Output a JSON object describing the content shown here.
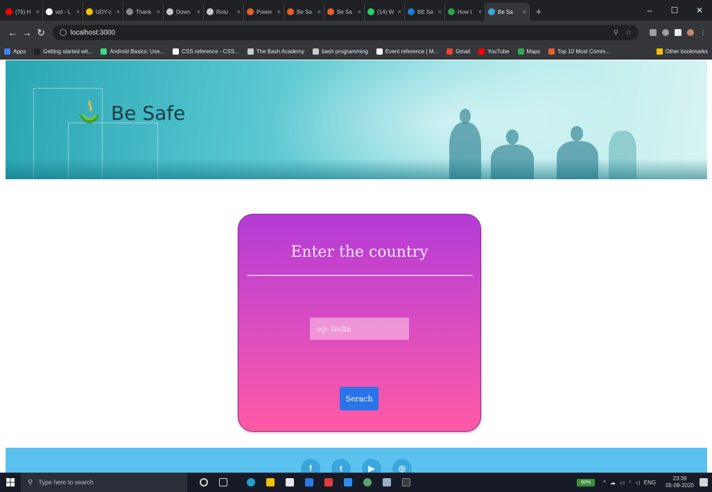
{
  "browser": {
    "tabs": [
      {
        "label": "(76) H",
        "favicon_color": "#ff0000"
      },
      {
        "label": "wd - L",
        "favicon_color": "#ffffff"
      },
      {
        "label": "UDY-c",
        "favicon_color": "#f2c200"
      },
      {
        "label": "Thank",
        "favicon_color": "#888888"
      },
      {
        "label": "Down",
        "favicon_color": "#c8c8c8"
      },
      {
        "label": "Rotu",
        "favicon_color": "#c8c8c8"
      },
      {
        "label": "Power",
        "favicon_color": "#e8602c"
      },
      {
        "label": "Be Sa",
        "favicon_color": "#e8602c"
      },
      {
        "label": "Be Sa",
        "favicon_color": "#e8602c"
      },
      {
        "label": "(14) W",
        "favicon_color": "#25d366"
      },
      {
        "label": "BE Sa",
        "favicon_color": "#1e7ad6"
      },
      {
        "label": "How t",
        "favicon_color": "#2ea44f"
      },
      {
        "label": "Be Sa",
        "favicon_color": "#3aa6dc"
      }
    ],
    "close_glyph": "×",
    "new_tab": "+",
    "url": "localhost:3000",
    "bookmarks": [
      {
        "label": "Apps",
        "color": "#4285f4"
      },
      {
        "label": "Getting started wit...",
        "color": "#222222"
      },
      {
        "label": "Android Basics: Use...",
        "color": "#3ddc84"
      },
      {
        "label": "CSS reference - CSS...",
        "color": "#ffffff"
      },
      {
        "label": "The Bash Academy",
        "color": "#cccccc"
      },
      {
        "label": "bash programming",
        "color": "#cccccc"
      },
      {
        "label": "Event reference | M...",
        "color": "#ffffff"
      },
      {
        "label": "Gmail",
        "color": "#ea4335"
      },
      {
        "label": "YouTube",
        "color": "#ff0000"
      },
      {
        "label": "Maps",
        "color": "#34a853"
      },
      {
        "label": "Top 10 Most Comm...",
        "color": "#e8602c"
      }
    ],
    "other_bookmarks": "Other bookmarks"
  },
  "site": {
    "brand": "Be Safe",
    "card_title": "Enter the country",
    "input_placeholder": "eg: India",
    "search_label": "Serach",
    "social": [
      {
        "name": "facebook",
        "glyph": "f"
      },
      {
        "name": "twitter",
        "glyph": "t"
      },
      {
        "name": "youtube",
        "glyph": "▶"
      },
      {
        "name": "instagram",
        "glyph": "◎"
      }
    ]
  },
  "taskbar": {
    "search_placeholder": "Type here to search",
    "battery": "60%",
    "lang": "ENG",
    "time": "23:39",
    "date": "05-09-2020"
  }
}
